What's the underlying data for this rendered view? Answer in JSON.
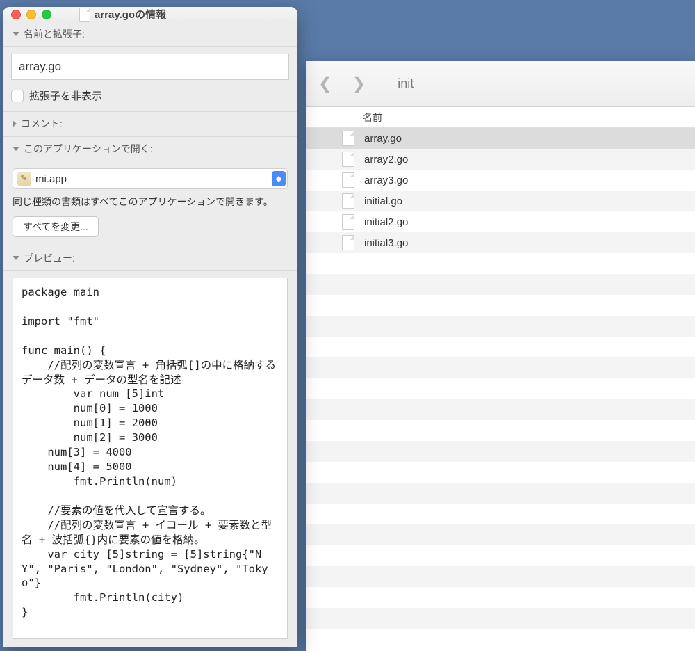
{
  "info_window": {
    "title": "array.goの情報",
    "sections": {
      "name_ext": {
        "label": "名前と拡張子:",
        "filename": "array.go",
        "hide_ext_label": "拡張子を非表示"
      },
      "comment": {
        "label": "コメント:"
      },
      "open_with": {
        "label": "このアプリケーションで開く:",
        "app": "mi.app",
        "help_text": "同じ種類の書類はすべてこのアプリケーションで開きます。",
        "change_all_label": "すべてを変更..."
      },
      "preview": {
        "label": "プレビュー:",
        "content": "package main\n\nimport \"fmt\"\n\nfunc main() {\n    //配列の変数宣言 + 角括弧[]の中に格納するデータ数 + データの型名を記述\n        var num [5]int\n        num[0] = 1000\n        num[1] = 2000\n        num[2] = 3000\n    num[3] = 4000\n    num[4] = 5000\n        fmt.Println(num)\n\n    //要素の値を代入して宣言する。\n    //配列の変数宣言 + イコール + 要素数と型名 + 波括弧{}内に要素の値を格納。\n    var city [5]string = [5]string{\"NY\", \"Paris\", \"London\", \"Sydney\", \"Tokyo\"}\n        fmt.Println(city)\n}"
      }
    }
  },
  "finder": {
    "folder": "init",
    "column_header": "名前",
    "files": [
      {
        "name": "array.go",
        "selected": true
      },
      {
        "name": "array2.go",
        "selected": false
      },
      {
        "name": "array3.go",
        "selected": false
      },
      {
        "name": "initial.go",
        "selected": false
      },
      {
        "name": "initial2.go",
        "selected": false
      },
      {
        "name": "initial3.go",
        "selected": false
      }
    ],
    "empty_rows": 18
  }
}
